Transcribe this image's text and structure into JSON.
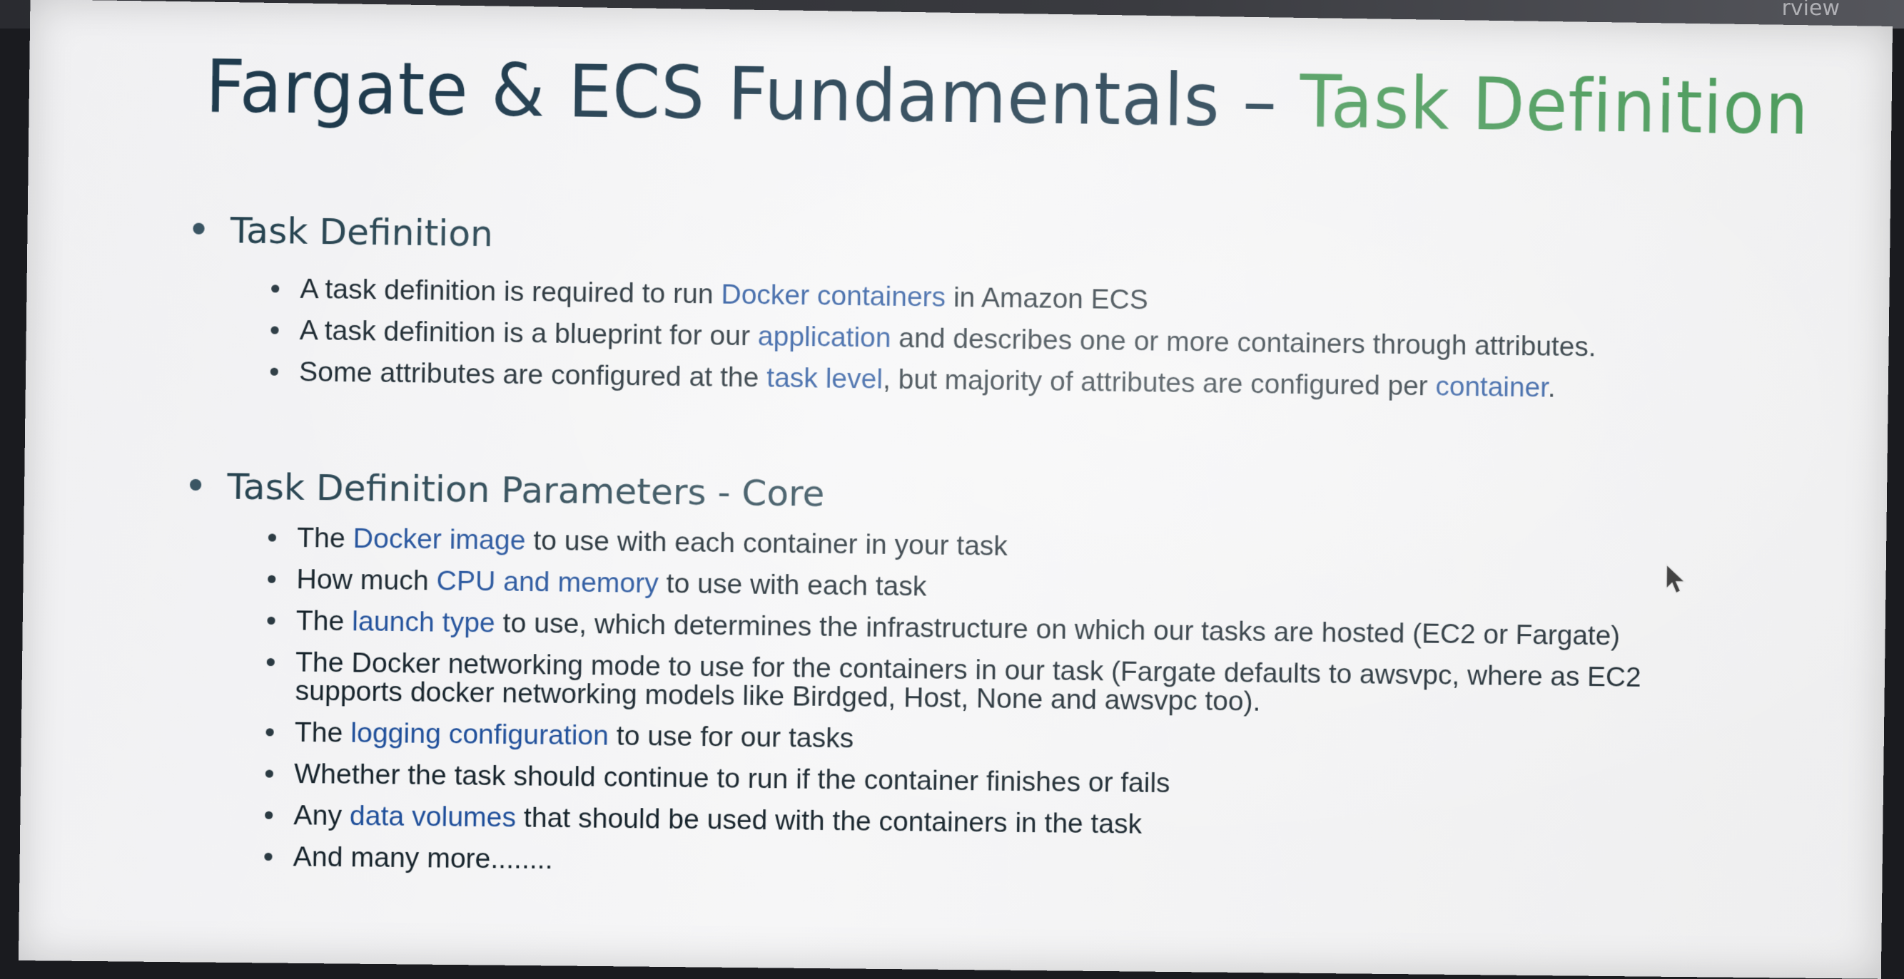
{
  "corner_text": "rview",
  "title": {
    "main": "Fargate & ECS Fundamentals",
    "dash": " – ",
    "accent": "Task Definition"
  },
  "section1": {
    "heading": "Task Definition",
    "items": [
      {
        "parts": [
          {
            "t": "A task definition is required to run "
          },
          {
            "t": "Docker containers",
            "hl": true
          },
          {
            "t": " in Amazon ECS"
          }
        ]
      },
      {
        "parts": [
          {
            "t": "A task definition is a blueprint for our "
          },
          {
            "t": "application",
            "hl": true
          },
          {
            "t": " and describes one or more containers through attributes."
          }
        ]
      },
      {
        "parts": [
          {
            "t": "Some attributes are configured at the "
          },
          {
            "t": "task level",
            "hl": true
          },
          {
            "t": ", but majority of attributes are configured per "
          },
          {
            "t": "container",
            "hl": true
          },
          {
            "t": "."
          }
        ]
      }
    ]
  },
  "section2": {
    "heading": "Task Definition Parameters  - Core",
    "items": [
      {
        "parts": [
          {
            "t": "The "
          },
          {
            "t": "Docker image",
            "hl": true
          },
          {
            "t": " to use with each container in your task"
          }
        ]
      },
      {
        "parts": [
          {
            "t": "How much "
          },
          {
            "t": "CPU and memory",
            "hl": true
          },
          {
            "t": " to use with each task"
          }
        ]
      },
      {
        "parts": [
          {
            "t": "The "
          },
          {
            "t": "launch type",
            "hl": true
          },
          {
            "t": " to use, which determines the infrastructure on which our tasks are hosted (EC2 or Fargate)"
          }
        ]
      },
      {
        "parts": [
          {
            "t": "The Docker networking mode to use for the containers in our task (Fargate defaults to awsvpc, where as EC2 supports docker networking models like Birdged, Host, None and awsvpc too)."
          }
        ]
      },
      {
        "parts": [
          {
            "t": "The "
          },
          {
            "t": "logging configuration",
            "hl": true
          },
          {
            "t": " to use for our tasks"
          }
        ]
      },
      {
        "parts": [
          {
            "t": "Whether the task should continue to run if the container finishes or fails"
          }
        ]
      },
      {
        "parts": [
          {
            "t": "Any "
          },
          {
            "t": "data volumes",
            "hl": true
          },
          {
            "t": " that should be used with the containers in the task"
          }
        ]
      },
      {
        "parts": [
          {
            "t": "And many more........"
          }
        ]
      }
    ]
  },
  "colors": {
    "title": "#1f3b4d",
    "title_accent": "#4a9a5a",
    "highlight": "#1f4f9a",
    "body_text": "#16232b"
  }
}
